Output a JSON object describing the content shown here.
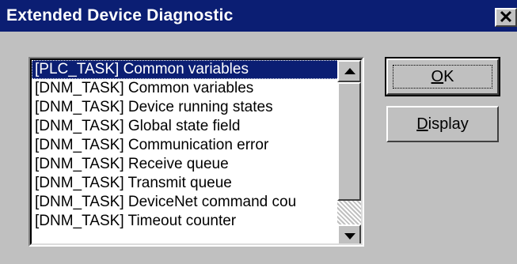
{
  "window": {
    "title": "Extended Device Diagnostic",
    "close_glyph": "✕",
    "titlebar_color": "#0b1e73"
  },
  "list": {
    "selected_index": 0,
    "items": [
      "[PLC_TASK] Common variables",
      "[DNM_TASK] Common variables",
      "[DNM_TASK] Device running states",
      "[DNM_TASK] Global state field",
      "[DNM_TASK] Communication error",
      "[DNM_TASK] Receive queue",
      "[DNM_TASK] Transmit queue",
      "[DNM_TASK] DeviceNet command cou",
      "[DNM_TASK] Timeout counter"
    ]
  },
  "buttons": {
    "ok": {
      "mnemonic": "O",
      "rest": "K"
    },
    "display": {
      "mnemonic": "D",
      "rest": "isplay"
    }
  }
}
